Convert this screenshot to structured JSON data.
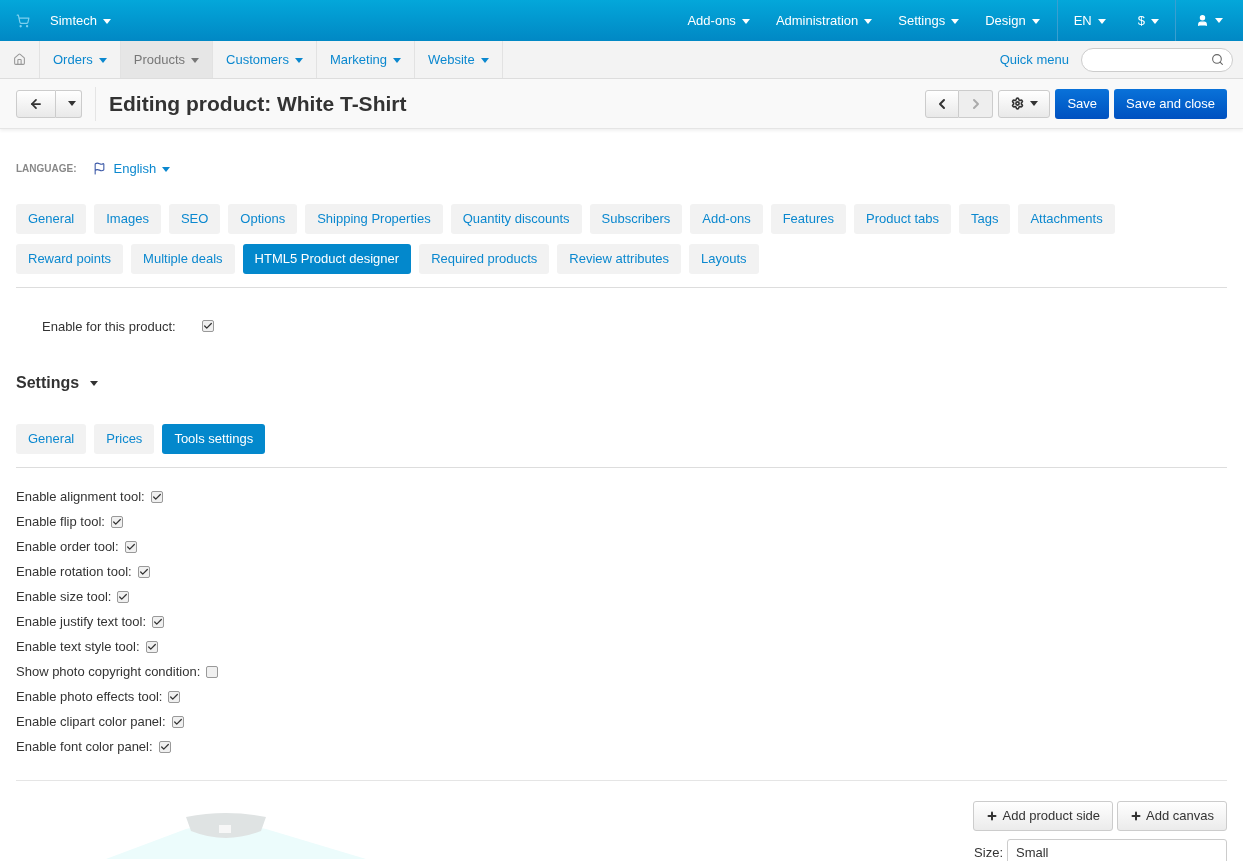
{
  "top_bar": {
    "store": "Simtech",
    "menus": [
      {
        "label": "Add-ons"
      },
      {
        "label": "Administration"
      },
      {
        "label": "Settings"
      },
      {
        "label": "Design"
      }
    ],
    "language": "EN",
    "currency": "$"
  },
  "nav": {
    "items": [
      {
        "label": "Orders",
        "selected": false
      },
      {
        "label": "Products",
        "selected": true
      },
      {
        "label": "Customers",
        "selected": false
      },
      {
        "label": "Marketing",
        "selected": false
      },
      {
        "label": "Website",
        "selected": false
      }
    ],
    "quick_menu": "Quick menu"
  },
  "header": {
    "title": "Editing product: White T-Shirt",
    "buttons": [
      "Save",
      "Save and close"
    ]
  },
  "language": {
    "label": "LANGUAGE:",
    "value": "English"
  },
  "tabs": [
    {
      "label": "General",
      "selected": false
    },
    {
      "label": "Images",
      "selected": false
    },
    {
      "label": "SEO",
      "selected": false
    },
    {
      "label": "Options",
      "selected": false
    },
    {
      "label": "Shipping Properties",
      "selected": false
    },
    {
      "label": "Quantity discounts",
      "selected": false
    },
    {
      "label": "Subscribers",
      "selected": false
    },
    {
      "label": "Add-ons",
      "selected": false
    },
    {
      "label": "Features",
      "selected": false
    },
    {
      "label": "Product tabs",
      "selected": false
    },
    {
      "label": "Tags",
      "selected": false
    },
    {
      "label": "Attachments",
      "selected": false
    },
    {
      "label": "Reward points",
      "selected": false
    },
    {
      "label": "Multiple deals",
      "selected": false
    },
    {
      "label": "HTML5 Product designer",
      "selected": true
    },
    {
      "label": "Required products",
      "selected": false
    },
    {
      "label": "Review attributes",
      "selected": false
    },
    {
      "label": "Layouts",
      "selected": false
    }
  ],
  "enable": {
    "label": "Enable for this product:",
    "checked": true
  },
  "settings": {
    "title": "Settings",
    "tabs": [
      {
        "label": "General",
        "selected": false
      },
      {
        "label": "Prices",
        "selected": false
      },
      {
        "label": "Tools settings",
        "selected": true
      }
    ],
    "options": [
      {
        "label": "Enable alignment tool:",
        "checked": true
      },
      {
        "label": "Enable flip tool:",
        "checked": true
      },
      {
        "label": "Enable order tool:",
        "checked": true
      },
      {
        "label": "Enable rotation tool:",
        "checked": true
      },
      {
        "label": "Enable size tool:",
        "checked": true
      },
      {
        "label": "Enable justify text tool:",
        "checked": true
      },
      {
        "label": "Enable text style tool:",
        "checked": true
      },
      {
        "label": "Show photo copyright condition:",
        "checked": false
      },
      {
        "label": "Enable photo effects tool:",
        "checked": true
      },
      {
        "label": "Enable clipart color panel:",
        "checked": true
      },
      {
        "label": "Enable font color panel:",
        "checked": true
      }
    ]
  },
  "designer": {
    "buttons": [
      "Add product side",
      "Add canvas"
    ],
    "size_label": "Size:",
    "size_value": "Small"
  }
}
